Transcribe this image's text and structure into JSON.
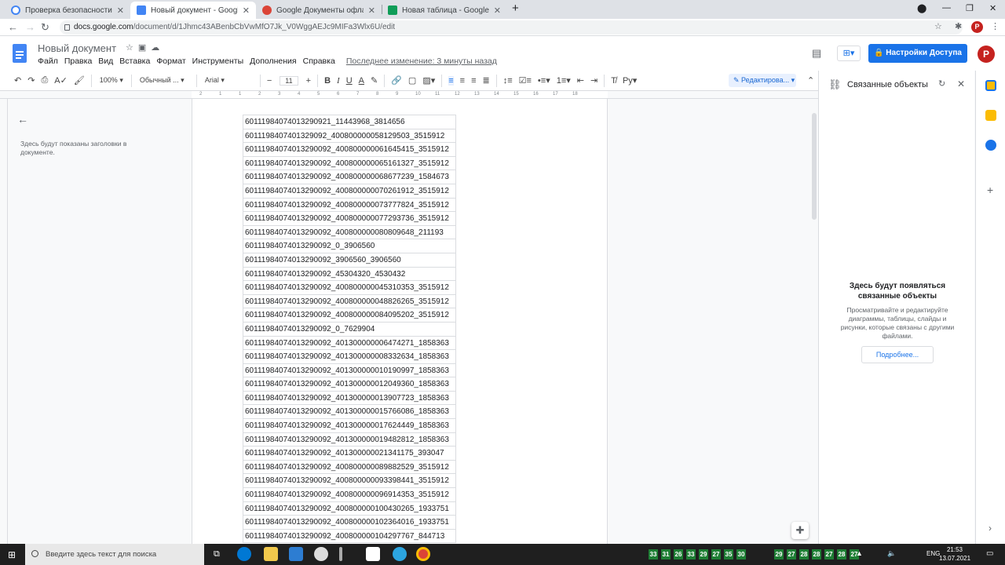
{
  "browser": {
    "tabs": [
      {
        "title": "Проверка безопасности",
        "favicon_color": "#4285f4"
      },
      {
        "title": "Новый документ - Google Докум",
        "favicon_color": "#4285f4"
      },
      {
        "title": "Google Документы офлайн - Ин",
        "favicon_color": "#db4437"
      },
      {
        "title": "Новая таблица - Google Таблиц",
        "favicon_color": "#0f9d58"
      }
    ],
    "new_tab": "+",
    "url_host": "docs.google.com",
    "url_path": "/document/d/1Jhmc43ABenbCbVwMfO7Jk_V0WggAEJc9MIFa3Wlx6U/edit",
    "profile_letter": "P"
  },
  "docs": {
    "title": "Новый документ",
    "menu": [
      "Файл",
      "Правка",
      "Вид",
      "Вставка",
      "Формат",
      "Инструменты",
      "Дополнения",
      "Справка"
    ],
    "last_edit": "Последнее изменение: 3 минуты назад",
    "share_label": "Настройки Доступа",
    "avatar_letter": "P",
    "accent": "#1a73e8"
  },
  "toolbar": {
    "zoom": "100%",
    "style": "Обычный ...",
    "font": "Arial",
    "font_size": "11",
    "mode": "Редактирова..."
  },
  "ruler_ticks": [
    "2",
    "1",
    "1",
    "2",
    "3",
    "4",
    "5",
    "6",
    "7",
    "8",
    "9",
    "10",
    "11",
    "12",
    "13",
    "14",
    "15",
    "16",
    "17",
    "18"
  ],
  "outline": {
    "hint": "Здесь будут показаны заголовки в документе."
  },
  "cells": [
    "60111984074013290921_11443968_3814656",
    "601119840740132909​2_400800000058129503_3515912",
    "60111984074013290092_400800000061645415_3515912",
    "60111984074013290092_400800000065161327_3515912",
    "60111984074013290092_400800000068677239_1584673",
    "60111984074013290092_400800000070261912_3515912",
    "60111984074013290092_400800000073777824_3515912",
    "60111984074013290092_400800000077293736_3515912",
    "60111984074013290092_400800000080809648_211193",
    "60111984074013290092_0_3906560",
    "60111984074013290092_3906560_3906560",
    "60111984074013290092_45304320_4530432",
    "60111984074013290092_400800000045310353_3515912",
    "60111984074013290092_400800000048826265_3515912",
    "60111984074013290092_400800000084095202_3515912",
    "60111984074013290092_0_7629904",
    "60111984074013290092_401300000006474271_1858363",
    "60111984074013290092_401300000008332634_1858363",
    "60111984074013290092_401300000010190997_1858363",
    "60111984074013290092_401300000012049360_1858363",
    "60111984074013290092_401300000013907723_1858363",
    "60111984074013290092_401300000015766086_1858363",
    "60111984074013290092_401300000017624449_1858363",
    "60111984074013290092_401300000019482812_1858363",
    "60111984074013290092_401300000021341175_393047",
    "60111984074013290092_400800000089882529_3515912",
    "60111984074013290092_400800000093398441_3515912",
    "60111984074013290092_400800000096914353_3515912",
    "60111984074013290092_400800000100430265_1933751",
    "60111984074013290092_400800000102364016_1933751",
    "60111984074013290092_400800000104297767_844713"
  ],
  "side_panel": {
    "title": "Связанные объекты",
    "heading": "Здесь будут появляться связанные объекты",
    "description": "Просматривайте и редактируйте диаграммы, таблицы, слайды и рисунки, которые связаны с другими файлами.",
    "more": "Подробнее..."
  },
  "taskbar": {
    "search_placeholder": "Введите здесь текст для поиска",
    "tray_numbers": [
      "33",
      "31",
      "26",
      "33",
      "29",
      "27",
      "35",
      "30",
      "29",
      "27",
      "28",
      "28",
      "27",
      "28",
      "27"
    ],
    "lang": "ENG",
    "time": "21:53",
    "date": "13.07.2021"
  }
}
